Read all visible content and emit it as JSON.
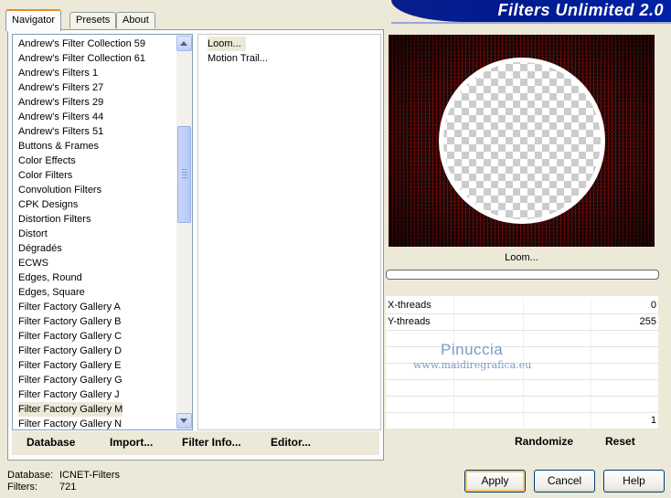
{
  "tabs": [
    {
      "label": "Navigator",
      "active": true
    },
    {
      "label": "Presets",
      "active": false
    },
    {
      "label": "About",
      "active": false
    }
  ],
  "banner": {
    "title": "Filters Unlimited 2.0"
  },
  "categories": {
    "selected": "Filter Factory Gallery M",
    "items": [
      "Andrew's Filter Collection 59",
      "Andrew's Filter Collection 61",
      "Andrew's Filters 1",
      "Andrew's Filters 27",
      "Andrew's Filters 29",
      "Andrew's Filters 44",
      "Andrew's Filters 51",
      "Buttons & Frames",
      "Color Effects",
      "Color Filters",
      "Convolution Filters",
      "CPK Designs",
      "Distortion Filters",
      "Distort",
      "Dégradés",
      "ECWS",
      "Edges, Round",
      "Edges, Square",
      "Filter Factory Gallery A",
      "Filter Factory Gallery B",
      "Filter Factory Gallery C",
      "Filter Factory Gallery D",
      "Filter Factory Gallery E",
      "Filter Factory Gallery G",
      "Filter Factory Gallery J",
      "Filter Factory Gallery M",
      "Filter Factory Gallery N"
    ]
  },
  "filters": {
    "selected": "Loom...",
    "items": [
      "Loom...",
      "Motion Trail..."
    ]
  },
  "bottom_actions": {
    "database": "Database",
    "import": "Import...",
    "filter_info": "Filter Info...",
    "editor": "Editor..."
  },
  "preview": {
    "caption": "Loom..."
  },
  "params": [
    {
      "label": "X-threads",
      "value": "0"
    },
    {
      "label": "Y-threads",
      "value": "255"
    },
    {
      "label": "",
      "value": ""
    },
    {
      "label": "",
      "value": ""
    },
    {
      "label": "",
      "value": ""
    },
    {
      "label": "",
      "value": ""
    },
    {
      "label": "",
      "value": ""
    },
    {
      "label": "",
      "value": "1"
    }
  ],
  "watermark": {
    "name": "Pinuccia",
    "url": "www.maidiregrafica.eu"
  },
  "right_actions": {
    "randomize": "Randomize",
    "reset": "Reset"
  },
  "footer": {
    "database_label": "Database:",
    "database_value": "ICNET-Filters",
    "filters_label": "Filters:",
    "filters_value": "721"
  },
  "dialog_buttons": {
    "apply": "Apply",
    "cancel": "Cancel",
    "help": "Help"
  },
  "colors": {
    "banner": "#001a8c",
    "preview_bg": "#1a0605",
    "thread": "#8b1010"
  }
}
